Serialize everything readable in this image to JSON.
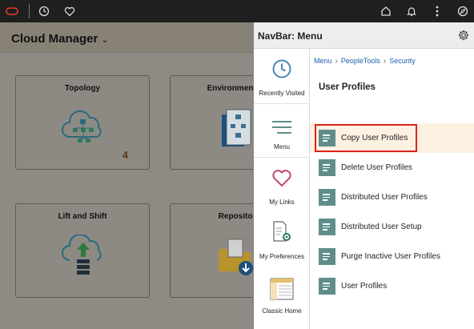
{
  "topbar": {
    "icons": [
      "oracle-logo-icon",
      "history-icon",
      "favorites-heart-icon",
      "home-icon",
      "notification-bell-icon",
      "actions-menu-icon",
      "navbar-compass-icon"
    ]
  },
  "background_page": {
    "title": "Cloud Manager",
    "tiles": [
      {
        "title": "Topology",
        "count": "4",
        "icon": "cloud-network-icon"
      },
      {
        "title": "Environment Te",
        "count": "",
        "icon": "template-document-icon"
      },
      {
        "title": "Lift and Shift",
        "count": "",
        "icon": "cloud-upload-icon"
      },
      {
        "title": "Repositor",
        "count": "",
        "icon": "folder-download-icon"
      }
    ]
  },
  "navbar": {
    "title": "NavBar: Menu",
    "side_items": [
      {
        "label": "Recently Visited",
        "icon": "clock-icon"
      },
      {
        "label": "Menu",
        "icon": "hamburger-menu-icon",
        "active": true
      },
      {
        "label": "My Links",
        "icon": "heart-icon"
      },
      {
        "label": "My Preferences",
        "icon": "preferences-gear-icon"
      },
      {
        "label": "Classic Home",
        "icon": "classic-home-icon"
      }
    ],
    "breadcrumb": [
      "Menu",
      "PeopleTools",
      "Security"
    ],
    "section_title": "User Profiles",
    "menu_items": [
      {
        "label": "Copy User Profiles",
        "selected": true
      },
      {
        "label": "Delete User Profiles"
      },
      {
        "label": "Distributed User Profiles"
      },
      {
        "label": "Distributed User Setup"
      },
      {
        "label": "Purge Inactive User Profiles"
      },
      {
        "label": "User Profiles"
      }
    ]
  },
  "colors": {
    "accent_teal": "#5f8e8a",
    "highlight": "#d9231f",
    "selected_row": "#fdf1e2",
    "link": "#1b5fa8"
  }
}
